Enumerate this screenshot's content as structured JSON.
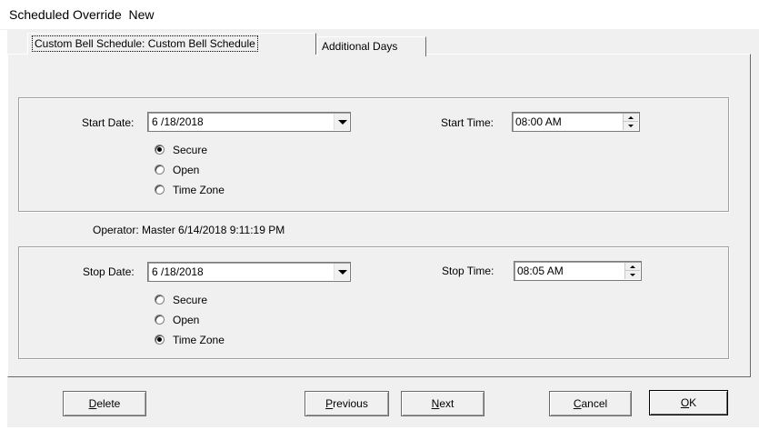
{
  "window": {
    "title": "Scheduled Override  New"
  },
  "tabs": [
    {
      "label": "Custom Bell Schedule:  Custom Bell Schedule",
      "active": true
    },
    {
      "label": "Additional Days",
      "active": false
    }
  ],
  "start": {
    "date_label": "Start Date:",
    "date_value": "6 /18/2018",
    "time_label": "Start Time:",
    "time_value": "08:00 AM",
    "options": [
      {
        "label": "Secure",
        "selected": true
      },
      {
        "label": "Open",
        "selected": false
      },
      {
        "label": "Time Zone",
        "selected": false
      }
    ]
  },
  "operator": {
    "text": "Operator:  Master  6/14/2018 9:11:19 PM"
  },
  "stop": {
    "date_label": "Stop Date:",
    "date_value": "6 /18/2018",
    "time_label": "Stop Time:",
    "time_value": "08:05 AM",
    "options": [
      {
        "label": "Secure",
        "selected": false
      },
      {
        "label": "Open",
        "selected": false
      },
      {
        "label": "Time Zone",
        "selected": true
      }
    ]
  },
  "buttons": {
    "delete": {
      "first": "D",
      "rest": "elete"
    },
    "previous": {
      "first": "P",
      "rest": "revious"
    },
    "next": {
      "first": "N",
      "rest": "ext"
    },
    "cancel": {
      "first": "C",
      "rest": "ancel"
    },
    "ok": {
      "first": "O",
      "rest": "K"
    }
  }
}
